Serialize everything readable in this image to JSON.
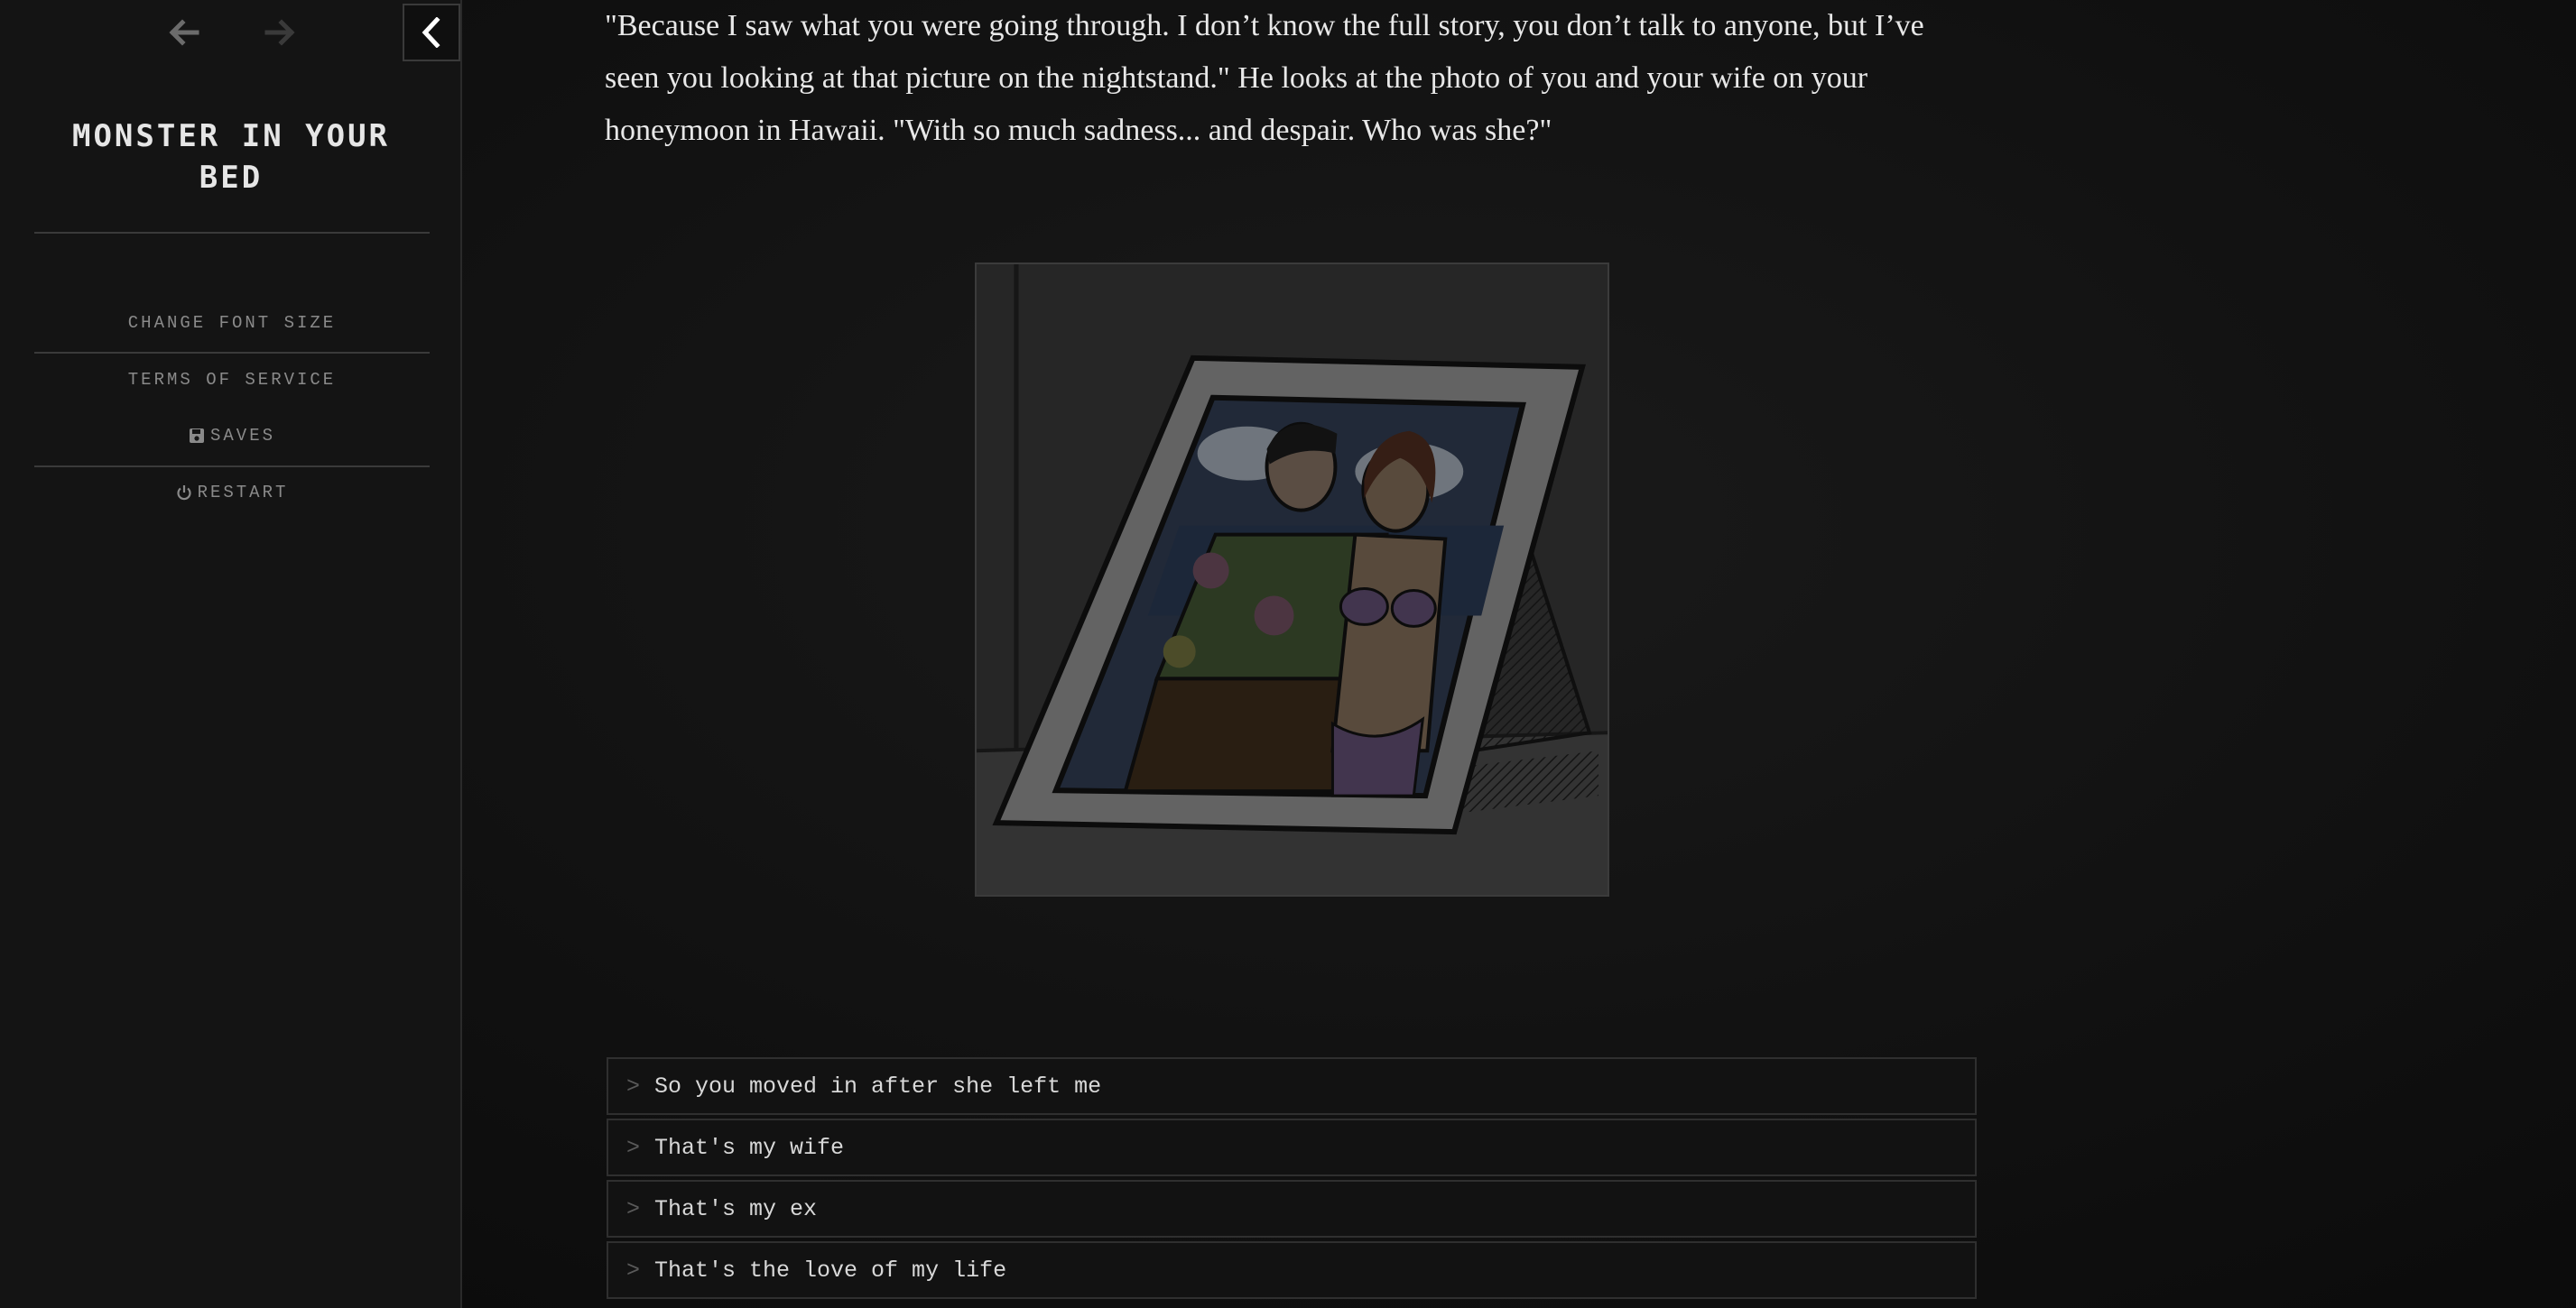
{
  "sidebar": {
    "title": "Monster in your bed",
    "links": {
      "font_size": "Change font size",
      "terms": "Terms of service",
      "saves": "Saves",
      "restart": "Restart"
    }
  },
  "icons": {
    "back": "arrow-left-icon",
    "forward": "arrow-right-icon",
    "collapse": "chevron-left-icon",
    "saves": "floppy-disk-icon",
    "restart": "power-icon"
  },
  "story": {
    "paragraph": "\"Because I saw what you were going through. I don’t know the full story, you don’t talk to anyone, but I’ve seen you looking at that picture on the nightstand.\" He looks at the photo of you and your wife on your honeymoon in Hawaii. \"With so much sadness... and despair. Who was she?\""
  },
  "choices": [
    {
      "marker": ">",
      "label": "So you moved in after she left me"
    },
    {
      "marker": ">",
      "label": "That's my wife"
    },
    {
      "marker": ">",
      "label": "That's my ex"
    },
    {
      "marker": ">",
      "label": "That's the love of my life"
    }
  ],
  "colors": {
    "background": "#0d0d0d",
    "sidebar": "#141414",
    "text": "#e8e8e8",
    "muted": "#8a8a8a",
    "border": "#2f2f2f"
  }
}
